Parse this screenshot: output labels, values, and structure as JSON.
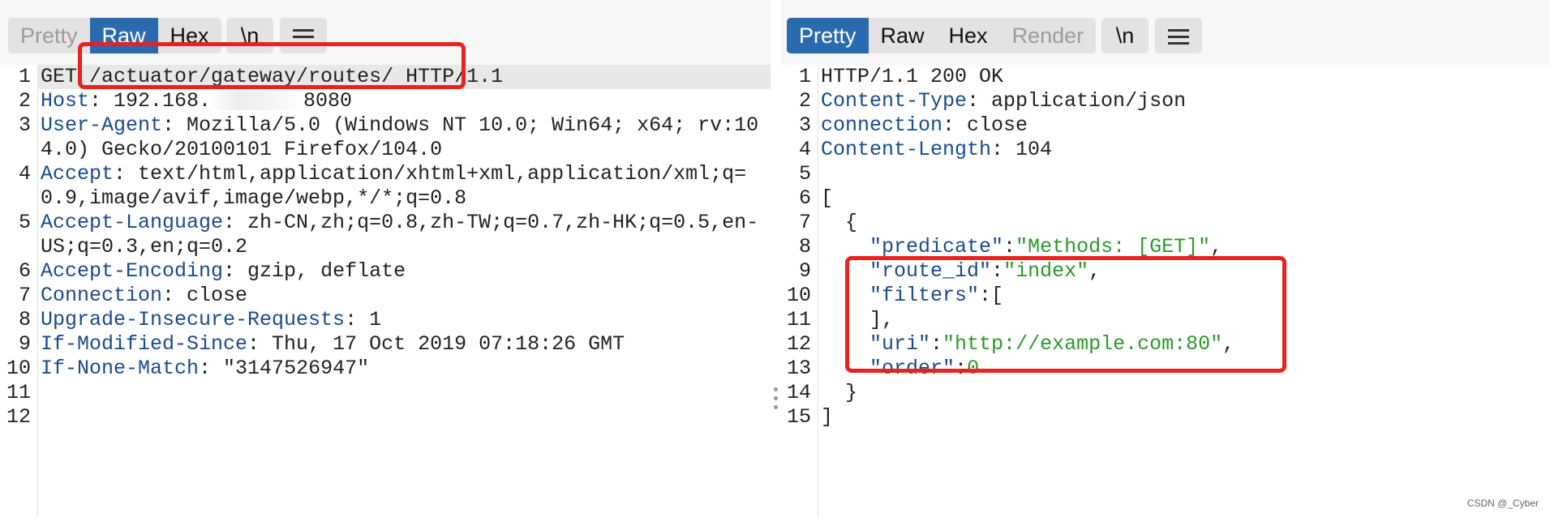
{
  "request": {
    "tabs": [
      "Pretty",
      "Raw",
      "Hex"
    ],
    "active_tab": "Raw",
    "dim_tabs": [
      "Pretty"
    ],
    "newline_label": "\\n",
    "menu_icon": "hamburger-menu-icon",
    "lines": [
      [
        {
          "t": "GET /actuator/gateway/routes/ HTTP/1.1"
        }
      ],
      [
        {
          "t": "Host",
          "c": "k"
        },
        {
          "t": ": 192.168."
        },
        {
          "blur": true
        },
        {
          "t": "8080"
        }
      ],
      [
        {
          "t": "User-Agent",
          "c": "k"
        },
        {
          "t": ": Mozilla/5.0 (Windows NT 10.0; Win64; x64; rv:104.0) Gecko/20100101 Firefox/104.0"
        }
      ],
      [
        {
          "t": "Accept",
          "c": "k"
        },
        {
          "t": ": text/html,application/xhtml+xml,application/xml;q=0.9,image/avif,image/webp,*/*;q=0.8"
        }
      ],
      [
        {
          "t": "Accept-Language",
          "c": "k"
        },
        {
          "t": ": zh-CN,zh;q=0.8,zh-TW;q=0.7,zh-HK;q=0.5,en-US;q=0.3,en;q=0.2"
        }
      ],
      [
        {
          "t": "Accept-Encoding",
          "c": "k"
        },
        {
          "t": ": gzip, deflate"
        }
      ],
      [
        {
          "t": "Connection",
          "c": "k"
        },
        {
          "t": ": close"
        }
      ],
      [
        {
          "t": "Upgrade-Insecure-Requests",
          "c": "k"
        },
        {
          "t": ": 1"
        }
      ],
      [
        {
          "t": "If-Modified-Since",
          "c": "k"
        },
        {
          "t": ": Thu, 17 Oct 2019 07:18:26 GMT"
        }
      ],
      [
        {
          "t": "If-None-Match",
          "c": "k"
        },
        {
          "t": ": \"3147526947\""
        }
      ],
      [],
      []
    ]
  },
  "response": {
    "tabs": [
      "Pretty",
      "Raw",
      "Hex",
      "Render"
    ],
    "active_tab": "Pretty",
    "dim_tabs": [
      "Render"
    ],
    "newline_label": "\\n",
    "menu_icon": "hamburger-menu-icon",
    "lines": [
      [
        {
          "t": "HTTP/1.1 200 OK"
        }
      ],
      [
        {
          "t": "Content-Type",
          "c": "k"
        },
        {
          "t": ": application/json"
        }
      ],
      [
        {
          "t": "connection",
          "c": "k"
        },
        {
          "t": ": close"
        }
      ],
      [
        {
          "t": "Content-Length",
          "c": "k"
        },
        {
          "t": ": 104"
        }
      ],
      [],
      [
        {
          "t": "["
        }
      ],
      [
        {
          "t": "  {"
        }
      ],
      [
        {
          "t": "    "
        },
        {
          "t": "\"predicate\"",
          "c": "k"
        },
        {
          "t": ":"
        },
        {
          "t": "\"Methods: [GET]\"",
          "c": "s"
        },
        {
          "t": ","
        }
      ],
      [
        {
          "t": "    "
        },
        {
          "t": "\"route_id\"",
          "c": "k"
        },
        {
          "t": ":"
        },
        {
          "t": "\"index\"",
          "c": "s"
        },
        {
          "t": ","
        }
      ],
      [
        {
          "t": "    "
        },
        {
          "t": "\"filters\"",
          "c": "k"
        },
        {
          "t": ":["
        }
      ],
      [
        {
          "t": "    ],"
        }
      ],
      [
        {
          "t": "    "
        },
        {
          "t": "\"uri\"",
          "c": "k"
        },
        {
          "t": ":"
        },
        {
          "t": "\"http://example.com:80\"",
          "c": "s"
        },
        {
          "t": ","
        }
      ],
      [
        {
          "t": "    "
        },
        {
          "t": "\"order\"",
          "c": "k"
        },
        {
          "t": ":"
        },
        {
          "t": "0",
          "c": "n"
        }
      ],
      [
        {
          "t": "  }"
        }
      ],
      [
        {
          "t": "]"
        }
      ]
    ]
  },
  "watermark": "CSDN @_Cyber"
}
